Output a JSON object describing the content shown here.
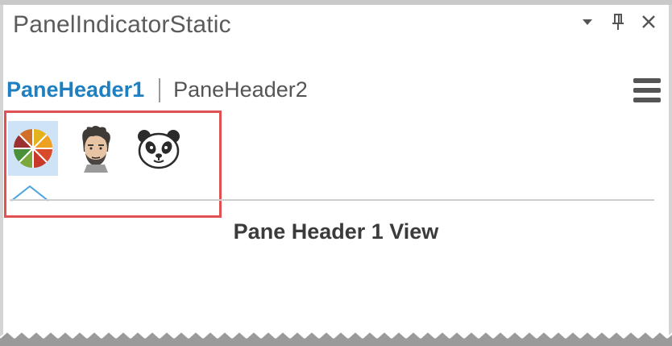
{
  "window": {
    "title": "PanelIndicatorStatic",
    "controls": [
      "dropdown-icon",
      "pin-icon",
      "close-icon"
    ]
  },
  "pane_headers": {
    "active_label": "PaneHeader1",
    "inactive_label": "PaneHeader2"
  },
  "header_buttons": [
    {
      "icon": "color-wheel-icon",
      "selected": true
    },
    {
      "icon": "man-face-icon",
      "selected": false
    },
    {
      "icon": "panda-face-icon",
      "selected": false
    }
  ],
  "view": {
    "title": "Pane Header 1 View"
  },
  "colors": {
    "accent": "#1e7fc1",
    "highlight_border": "#e05252",
    "selected_bg": "#cfe3f6"
  }
}
